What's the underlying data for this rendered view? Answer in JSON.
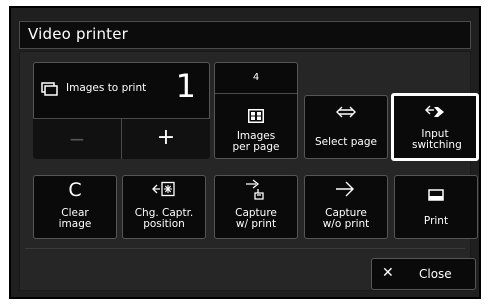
{
  "window": {
    "title": "Video printer"
  },
  "count": {
    "label": "Images to print",
    "value": "1"
  },
  "stepper": {
    "minus": "−",
    "plus": "+"
  },
  "per_page": {
    "value": "4",
    "label": "Images per page"
  },
  "buttons": {
    "select_page": "Select page",
    "input_switching": "Input switching",
    "clear_letter": "C",
    "clear": "Clear image",
    "chg_captr": "Chg. Captr. position",
    "capture_print": "Capture w/ print",
    "capture_noprint": "Capture w/o print",
    "print": "Print",
    "close": "Close",
    "close_glyph": "✕"
  }
}
